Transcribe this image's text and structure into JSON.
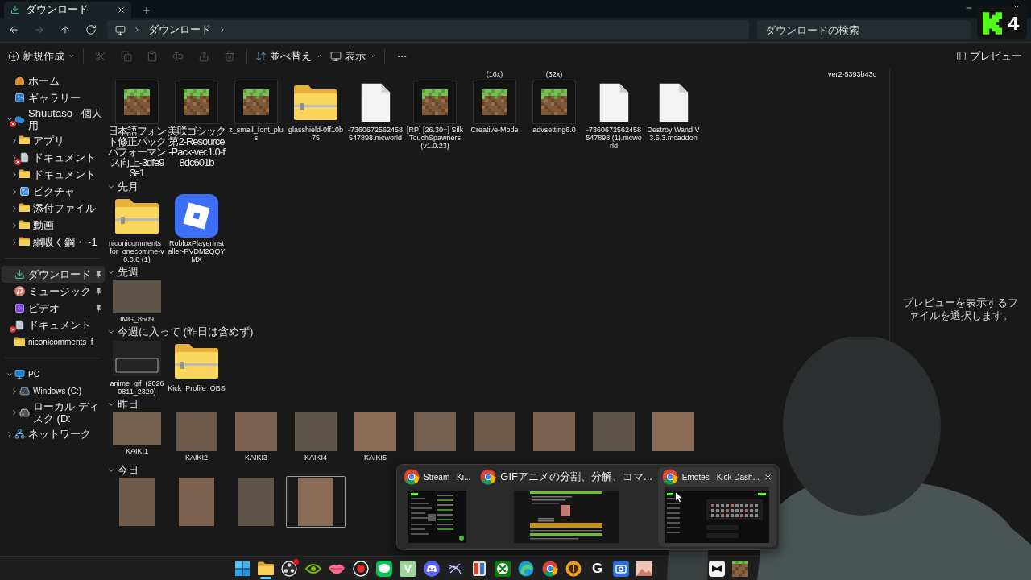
{
  "titlebar": {
    "tabs": [
      {
        "title": "ダウンロード",
        "selected": true
      }
    ]
  },
  "nav": [
    {
      "kind": "back",
      "disabled": false
    },
    {
      "kind": "forward",
      "disabled": true
    },
    {
      "kind": "up",
      "disabled": false
    },
    {
      "kind": "refresh",
      "disabled": false
    }
  ],
  "address": {
    "crumbs": [
      "ダウンロード"
    ]
  },
  "search": {
    "placeholder": "ダウンロードの検索"
  },
  "toolbar": {
    "items": [
      {
        "kind": "new",
        "label": "新規作成",
        "disabled": false
      },
      {
        "kind": "cut",
        "disabled": true
      },
      {
        "kind": "copy",
        "disabled": true
      },
      {
        "kind": "paste",
        "disabled": true
      },
      {
        "kind": "rename",
        "disabled": true
      },
      {
        "kind": "share",
        "disabled": true
      },
      {
        "kind": "delete",
        "disabled": true
      },
      {
        "kind": "sort",
        "label": "並べ替え",
        "disabled": false
      },
      {
        "kind": "view",
        "label": "表示",
        "disabled": false
      },
      {
        "kind": "more",
        "disabled": false
      }
    ],
    "preview_label": "プレビュー"
  },
  "sidebar": {
    "sections": [
      {
        "items": [
          {
            "kind": "home",
            "label": "ホーム",
            "selected": false,
            "error": false
          },
          {
            "kind": "gallery",
            "label": "ギャラリー",
            "selected": false,
            "error": false
          },
          {
            "kind": "cloud",
            "label": "Shuutaso - 個人用",
            "selected": false,
            "error": true,
            "expanded": true,
            "children": [
              {
                "kind": "folder",
                "label": "アプリ",
                "selected": false,
                "error": false,
                "expanded": false
              },
              {
                "kind": "document",
                "label": "ドキュメント",
                "selected": false,
                "error": true,
                "expanded": false
              },
              {
                "kind": "folder",
                "label": "ドキュメント",
                "selected": false,
                "error": false,
                "expanded": false
              },
              {
                "kind": "pictures",
                "label": "ピクチャ",
                "selected": false,
                "error": false,
                "expanded": false
              },
              {
                "kind": "folder",
                "label": "添付ファイル",
                "selected": false,
                "error": false,
                "expanded": false
              },
              {
                "kind": "folder",
                "label": "動画",
                "selected": false,
                "error": false,
                "expanded": false
              },
              {
                "kind": "folder",
                "label": "綱吸く鋼・~1",
                "selected": false,
                "error": false,
                "expanded": false
              }
            ]
          }
        ]
      },
      {
        "items": [
          {
            "kind": "download",
            "label": "ダウンロード",
            "selected": true,
            "error": false,
            "pinned": true
          },
          {
            "kind": "music",
            "label": "ミュージック",
            "selected": false,
            "error": false,
            "pinned": true
          },
          {
            "kind": "video",
            "label": "ビデオ",
            "selected": false,
            "error": false,
            "pinned": true
          },
          {
            "kind": "document",
            "label": "ドキュメント",
            "selected": false,
            "error": true,
            "pinned": false
          },
          {
            "kind": "folder",
            "label": "niconicomments_f",
            "selected": false,
            "error": false,
            "pinned": false
          }
        ]
      },
      {
        "items": [
          {
            "kind": "pc",
            "label": "PC",
            "selected": false,
            "error": false,
            "expanded": true,
            "children": [
              {
                "kind": "drive",
                "label": "Windows (C:)",
                "selected": false,
                "error": false,
                "expanded": false
              },
              {
                "kind": "disk",
                "label": "ローカル ディスク (D:",
                "selected": false,
                "error": false,
                "expanded": false
              }
            ]
          },
          {
            "kind": "network",
            "label": "ネットワーク",
            "selected": false,
            "error": false,
            "expanded": false
          }
        ]
      }
    ]
  },
  "groups": [
    {
      "items": [
        {
          "kind": "scrolled"
        },
        {
          "kind": "scrolled"
        },
        {
          "kind": "scrolled"
        },
        {
          "kind": "scrolled"
        },
        {
          "kind": "scrolled"
        },
        {
          "kind": "scrolled"
        },
        {
          "kind": "scrolled",
          "name": "(16x)"
        },
        {
          "kind": "scrolled",
          "name": "(32x)"
        },
        {
          "kind": "scrolled"
        },
        {
          "kind": "scrolled"
        },
        {
          "kind": "scrolled"
        },
        {
          "kind": "scrolled"
        },
        {
          "kind": "scrolled",
          "name": "ver2-5393b43c"
        },
        {
          "kind": "grass",
          "name": "日本語フォント修正パックパフォーマンス向上-3dfe93e1",
          "selected": false
        },
        {
          "kind": "grass",
          "name": "美咲ゴシック第2-Resource-Pack-ver.1.0-f8dc601b",
          "selected": false
        },
        {
          "kind": "grass",
          "name": "z_small_font_plus",
          "selected": false
        },
        {
          "kind": "zip",
          "name": "glasshield-0ff10b75",
          "selected": false
        },
        {
          "kind": "file",
          "name": "-7360672562458547898.mcworld",
          "selected": false
        },
        {
          "kind": "grass",
          "name": "[RP] [26.30+] SilkTouchSpawners (v1.0.23)",
          "selected": false
        },
        {
          "kind": "grass",
          "name": "Creative-Mode",
          "selected": false
        },
        {
          "kind": "grass",
          "name": "advsetting6.0",
          "selected": false
        },
        {
          "kind": "file",
          "name": "-7360672562458547898 (1).mcworld",
          "selected": false
        },
        {
          "kind": "file",
          "name": "Destroy Wand V3.5.3.mcaddon",
          "selected": false
        }
      ]
    },
    {
      "title": "先月",
      "expanded": true,
      "items": [
        {
          "kind": "zip",
          "name": "niconicomments_for_onecomme-v0.0.8 (1)",
          "selected": false
        },
        {
          "kind": "app",
          "name": "RobloxPlayerInstaller-PVDM2QQYMX",
          "selected": false
        }
      ]
    },
    {
      "title": "先週",
      "expanded": true,
      "items": [
        {
          "kind": "landscape",
          "name": "IMG_8509",
          "selected": false
        }
      ]
    },
    {
      "title": "今週に入って (昨日は含めず)",
      "expanded": true,
      "items": [
        {
          "kind": "screen",
          "name": "anime_gif_(20260811_2320)",
          "selected": false
        },
        {
          "kind": "zip",
          "name": "Kick_Profile_OBS",
          "selected": false
        }
      ]
    },
    {
      "title": "昨日",
      "expanded": true,
      "items": [
        {
          "kind": "landscape",
          "name": "KAIKI1",
          "selected": false
        },
        {
          "kind": "square",
          "name": "KAIKI2",
          "selected": false
        },
        {
          "kind": "square",
          "name": "KAIKI3",
          "selected": false
        },
        {
          "kind": "square",
          "name": "KAIKI4",
          "selected": false
        },
        {
          "kind": "square",
          "name": "KAIKI5",
          "selected": false
        },
        {
          "kind": "square",
          "selected": false
        },
        {
          "kind": "square",
          "selected": false
        },
        {
          "kind": "square",
          "selected": false
        },
        {
          "kind": "square",
          "selected": false
        },
        {
          "kind": "square",
          "selected": false
        }
      ]
    },
    {
      "title": "今日",
      "expanded": true,
      "items": [
        {
          "kind": "portrait",
          "selected": false
        },
        {
          "kind": "portrait",
          "selected": false
        },
        {
          "kind": "portrait",
          "selected": false
        },
        {
          "kind": "portrait",
          "selected": true
        }
      ]
    }
  ],
  "preview_pane": {
    "message": "プレビューを表示するファイルを選択します。"
  },
  "taskbar": {
    "icons_left": [
      {
        "kind": "start",
        "active": false,
        "badge": false
      },
      {
        "kind": "folder",
        "active": true,
        "badge": false
      },
      {
        "kind": "ring",
        "active": false,
        "badge": true
      },
      {
        "kind": "eye",
        "active": false,
        "badge": false
      },
      {
        "kind": "lips",
        "active": false,
        "badge": false
      },
      {
        "kind": "record",
        "active": false,
        "badge": false
      },
      {
        "kind": "chat",
        "active": false,
        "badge": false
      },
      {
        "kind": "tile",
        "glyph": "V",
        "active": false,
        "badge": false
      },
      {
        "kind": "controller",
        "active": false,
        "badge": false
      },
      {
        "kind": "scribble",
        "active": false,
        "badge": false
      },
      {
        "kind": "cards",
        "active": false,
        "badge": false
      },
      {
        "kind": "xsphere",
        "active": false,
        "badge": false
      },
      {
        "kind": "swirl",
        "active": false,
        "badge": false
      },
      {
        "kind": "segments",
        "active": false,
        "badge": false
      },
      {
        "kind": "coin",
        "active": false,
        "badge": false
      },
      {
        "kind": "glyph",
        "glyph": "G",
        "active": false,
        "badge": false
      },
      {
        "kind": "camera",
        "active": false,
        "badge": false
      },
      {
        "kind": "picture",
        "active": false,
        "badge": false
      }
    ],
    "icons_right": [
      {
        "kind": "squarelogo",
        "active": false,
        "badge": false
      },
      {
        "kind": "block",
        "active": false,
        "badge": false
      }
    ]
  },
  "taskbar_preview": {
    "windows": [
      {
        "title": "Stream - Ki...",
        "kind": "columns",
        "hovered": false
      },
      {
        "title": "GIFアニメの分割、分解、コマ...",
        "kind": "article",
        "hovered": false
      },
      {
        "title": "Emotes - Kick Dash...",
        "kind": "grid",
        "hovered": true
      }
    ]
  },
  "stream_badge": {
    "count": "4"
  }
}
